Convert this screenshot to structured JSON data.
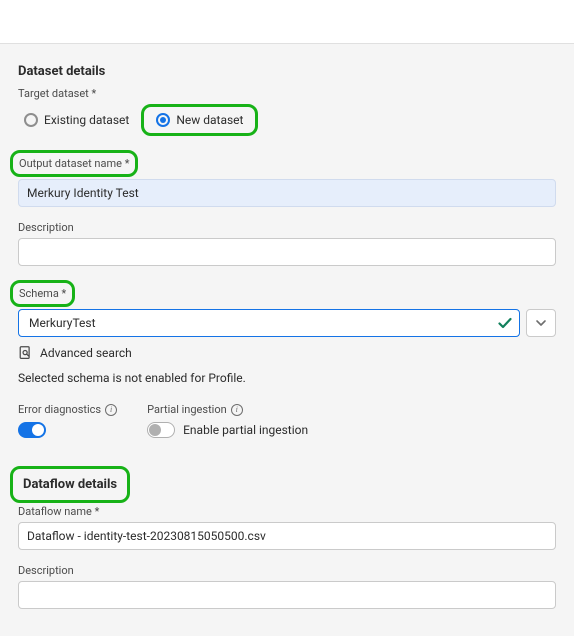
{
  "dataset": {
    "section_title": "Dataset details",
    "target_label": "Target dataset",
    "radio_existing": "Existing dataset",
    "radio_new": "New dataset",
    "output_name_label": "Output dataset name",
    "output_name_value": "Merkury Identity Test",
    "description_label": "Description",
    "description_value": "",
    "schema_label": "Schema",
    "schema_value": "MerkuryTest",
    "advanced_search": "Advanced search",
    "profile_note": "Selected schema is not enabled for Profile."
  },
  "toggles": {
    "error_diag_label": "Error diagnostics",
    "partial_label": "Partial ingestion",
    "partial_text": "Enable partial ingestion"
  },
  "dataflow": {
    "section_title": "Dataflow details",
    "name_label": "Dataflow name",
    "name_value": "Dataflow - identity-test-20230815050500.csv",
    "description_label": "Description",
    "description_value": ""
  }
}
